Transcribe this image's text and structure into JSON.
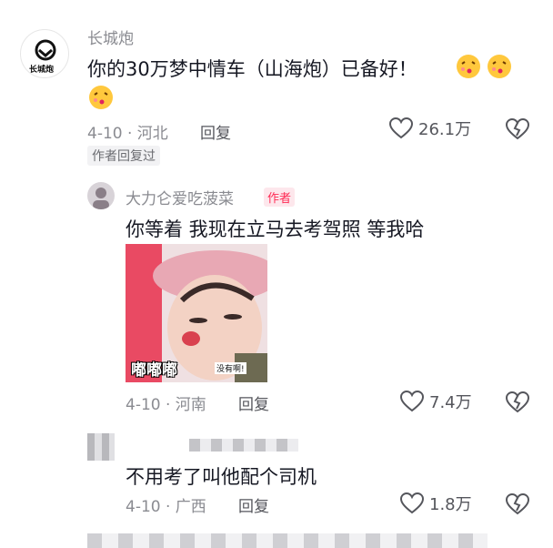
{
  "comments": [
    {
      "username": "长城炮",
      "avatar_label": "长城炮",
      "text": "你的30万梦中情车（山海炮）已备好！",
      "emojis": [
        "kiss-face",
        "kiss-face",
        "kiss-face"
      ],
      "date_location": "4-10 · 河北",
      "reply_label": "回复",
      "likes": "26.1万",
      "tag": "作者回复过"
    },
    {
      "username": "大力仑爱吃菠菜",
      "badge": "作者",
      "text": "你等着 我现在立马去考驾照 等我哈",
      "sticker_caption": "嘟嘟嘟",
      "sticker_small": "没有啊!",
      "date_location": "4-10 · 河南",
      "reply_label": "回复",
      "likes": "7.4万"
    },
    {
      "text": "不用考了叫他配个司机",
      "date_location": "4-10 · 广西",
      "reply_label": "回复",
      "likes": "1.8万"
    }
  ],
  "colors": {
    "accent": "#fe2c55",
    "muted": "#8a8b91"
  }
}
